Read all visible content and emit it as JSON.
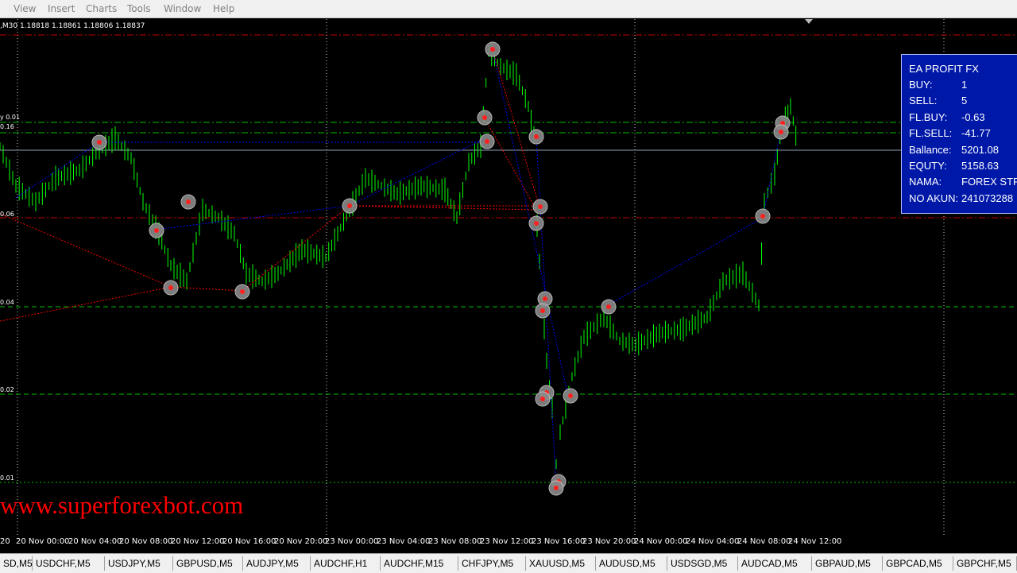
{
  "menu": [
    "View",
    "Insert",
    "Charts",
    "Tools",
    "Window",
    "Help"
  ],
  "chart": {
    "header": ",M30  1.18818 1.18861 1.18806 1.18837",
    "level_labels": [
      "y 0.01",
      "0.16",
      "0.06",
      "0.04",
      "0.02",
      "0.01"
    ],
    "time_labels": [
      "20",
      "20 Nov 00:00",
      "20 Nov 04:00",
      "20 Nov 08:00",
      "20 Nov 12:00",
      "20 Nov 16:00",
      "20 Nov 20:00",
      "23 Nov 00:00",
      "23 Nov 04:00",
      "23 Nov 08:00",
      "23 Nov 12:00",
      "23 Nov 16:00",
      "23 Nov 20:00",
      "24 Nov 00:00",
      "24 Nov 04:00",
      "24 Nov 08:00",
      "24 Nov 12:00"
    ],
    "watermark": "www.superforexbot.com",
    "colors": {
      "candle": "#00ff00",
      "sell_line": "#ff0000",
      "buy_line": "#0000ff",
      "level": "#00c000",
      "background": "#000000"
    }
  },
  "info_panel": {
    "title": "EA PROFIT FX",
    "rows": [
      {
        "label": "BUY:",
        "value": "1"
      },
      {
        "label": "SELL:",
        "value": "5"
      },
      {
        "label": "FL.BUY:",
        "value": "-0.63"
      },
      {
        "label": "FL.SELL:",
        "value": "-41.77"
      },
      {
        "label": "Ballance:",
        "value": "5201.08"
      },
      {
        "label": "EQUTY:",
        "value": "5158.63"
      },
      {
        "label": "NAMA:",
        "value": "FOREX STR"
      },
      {
        "label": "NO AKUN:",
        "value": "241073288"
      }
    ]
  },
  "tabs": [
    "SD,M5",
    "USDCHF,M5",
    "USDJPY,M5",
    "GBPUSD,M5",
    "AUDJPY,M5",
    "AUDCHF,H1",
    "AUDCHF,M15",
    "CHFJPY,M5",
    "XAUUSD,M5",
    "AUDUSD,M5",
    "USDSGD,M5",
    "AUDCAD,M5",
    "GBPAUD,M5",
    "GBPCAD,M5",
    "GBPCHF,M5"
  ]
}
